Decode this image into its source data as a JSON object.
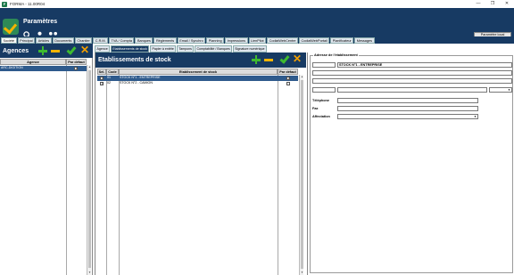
{
  "window": {
    "title": "FORMA - 11.00R04",
    "minimize": "—",
    "restore": "❐",
    "close": "✕"
  },
  "header": {
    "title": "Paramètres",
    "param_button": "Paramètre local",
    "icons": [
      "search-icon",
      "user-icon",
      "users-icon"
    ]
  },
  "main_tabs": [
    {
      "label": "Société",
      "active": true
    },
    {
      "label": "Principal"
    },
    {
      "label": "Articles"
    },
    {
      "label": "Documents"
    },
    {
      "label": "Chantier"
    },
    {
      "label": "C.R.M."
    },
    {
      "label": "TVA / Compta"
    },
    {
      "label": "Banques"
    },
    {
      "label": "Règlements"
    },
    {
      "label": "Email / Synchro"
    },
    {
      "label": "Planning"
    },
    {
      "label": "Impressions"
    },
    {
      "label": "LienPilot"
    },
    {
      "label": "CodialWebCentre"
    },
    {
      "label": "CodialWebPortail"
    },
    {
      "label": "Planificateur"
    },
    {
      "label": "Messages"
    }
  ],
  "agences": {
    "title": "Agences",
    "columns": [
      "Agence",
      "Par défaut"
    ],
    "rows": [
      {
        "agence": "ARC-DIGITION",
        "par_defaut": true
      }
    ]
  },
  "sub_tabs": [
    {
      "label": "Agence"
    },
    {
      "label": "Etablissements de stock",
      "active": true
    },
    {
      "label": "Papier à entête"
    },
    {
      "label": "Tampons"
    },
    {
      "label": "Comptabilité / Banques"
    },
    {
      "label": "Signature numérique"
    }
  ],
  "etablissements": {
    "title": "Etablissements de stock",
    "columns": [
      "Sel.",
      "Code",
      "Etablissement de stock",
      "Par défaut"
    ],
    "rows": [
      {
        "sel": true,
        "code": "01",
        "name": "STOCK N°1 - ENTREPRISE",
        "par_defaut": true,
        "selected": true
      },
      {
        "sel": true,
        "code": "02",
        "name": "STOCK N°2 - CAMION",
        "par_defaut": false,
        "selected": false
      }
    ]
  },
  "adresse": {
    "legend": "Adresse de l'établissement",
    "name_value": "STOCK N°1 - ENTREPRISE",
    "telephone_label": "Téléphone",
    "fax_label": "Fax",
    "affectation_label": "Affectation"
  },
  "colors": {
    "header_bg": "#173a63",
    "accent_green": "#3fba2f",
    "accent_orange": "#f5b400",
    "selection": "#2e5a8c"
  }
}
